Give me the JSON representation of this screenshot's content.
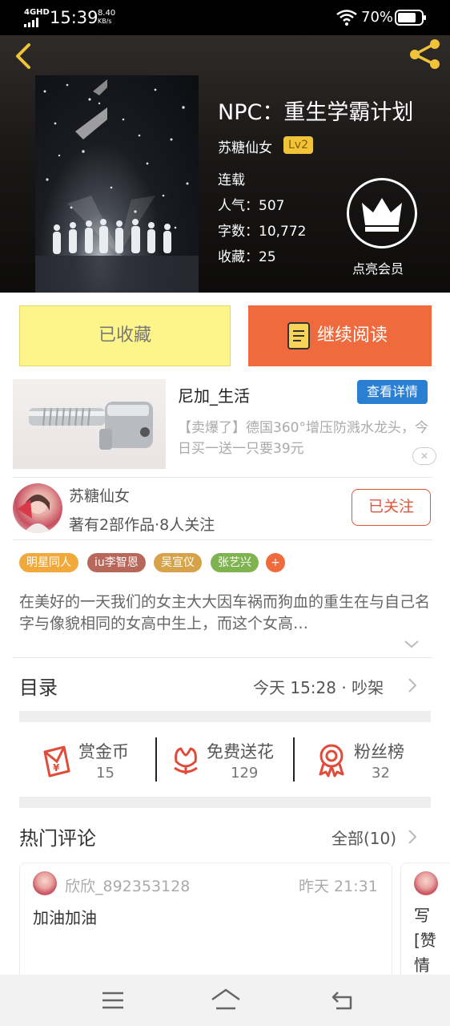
{
  "status_bar": {
    "network": "4GHD",
    "time": "15:39",
    "speed_value": "8.40",
    "speed_unit": "KB/s",
    "battery": "70%"
  },
  "book": {
    "title": "NPC：重生学霸计划",
    "author": "苏糖仙女",
    "author_level": "Lv2",
    "status": "连载",
    "popularity": "人气：507",
    "word_count": "字数：10,772",
    "favorites": "收藏：25",
    "vip_label": "点亮会员"
  },
  "actions": {
    "collect_label": "已收藏",
    "read_label": "继续阅读"
  },
  "ad": {
    "title": "尼加_生活",
    "detail_button": "查看详情",
    "description": "【卖爆了】德国360°增压防溅水龙头，今日买一送一只要39元",
    "close": "✕"
  },
  "author_info": {
    "name": "苏糖仙女",
    "meta": "著有2部作品·8人关注",
    "follow_label": "已关注"
  },
  "tags": [
    "明星同人",
    "iu李智恩",
    "吴宣仪",
    "张艺兴",
    "+"
  ],
  "tag_colors": [
    "#f2a93b",
    "#b8685a",
    "#d6a24a",
    "#7fb34f",
    "#ef6a3c"
  ],
  "description": "在美好的一天我们的女主大大因车祸而狗血的重生在与自己名字与像貌相同的女高中生上，而这个女高…",
  "catalog": {
    "title": "目录",
    "update": "今天 15:28 · 吵架"
  },
  "rewards": [
    {
      "label": "赏金币",
      "count": "15",
      "icon": "red-envelope-icon"
    },
    {
      "label": "免费送花",
      "count": "129",
      "icon": "flower-icon"
    },
    {
      "label": "粉丝榜",
      "count": "32",
      "icon": "medal-icon"
    }
  ],
  "comments": {
    "title": "热门评论",
    "all_label": "全部(10)",
    "items": [
      {
        "user": "欣欣_892353128",
        "time": "昨天 21:31",
        "text": "加油加油"
      },
      {
        "user": "",
        "time": "",
        "text": "写[赞情"
      }
    ]
  },
  "colors": {
    "accent_orange": "#ef6a3c",
    "collect_yellow": "#fdf48a",
    "level_badge": "#f0c338",
    "ad_button_blue": "#2a7fd3"
  }
}
